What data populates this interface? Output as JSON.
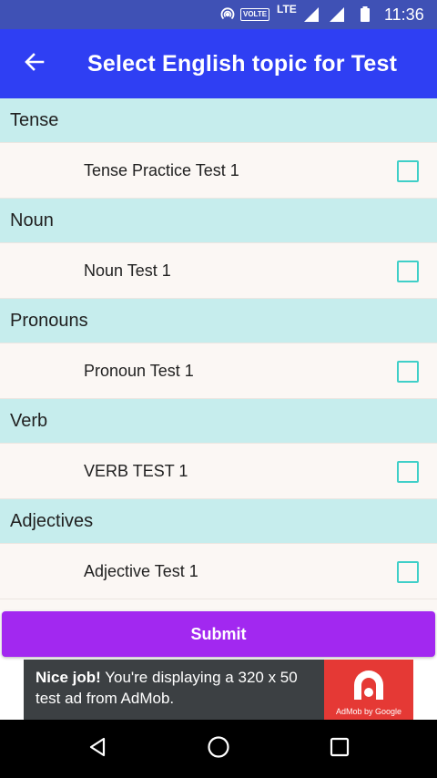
{
  "status_bar": {
    "network": "LTE",
    "volte": "VOLTE",
    "time": "11:36",
    "icons": [
      "hotspot-icon",
      "signal-icon",
      "signal-icon",
      "battery-icon"
    ]
  },
  "app_bar": {
    "title": "Select English topic for Test",
    "back_icon": "arrow-left-icon"
  },
  "sections": [
    {
      "header": "Tense",
      "tests": [
        {
          "label": "Tense Practice Test 1",
          "checked": false
        }
      ]
    },
    {
      "header": "Noun",
      "tests": [
        {
          "label": "Noun Test 1",
          "checked": false
        }
      ]
    },
    {
      "header": "Pronouns",
      "tests": [
        {
          "label": "Pronoun Test 1",
          "checked": false
        }
      ]
    },
    {
      "header": "Verb",
      "tests": [
        {
          "label": "VERB TEST 1",
          "checked": false
        }
      ]
    },
    {
      "header": "Adjectives",
      "tests": [
        {
          "label": "Adjective Test 1",
          "checked": false
        }
      ]
    }
  ],
  "submit": {
    "label": "Submit"
  },
  "ad": {
    "bold": "Nice job!",
    "text": " You're displaying a 320 x 50 test ad from AdMob.",
    "logo_caption": "AdMob by Google"
  },
  "nav_bar": {
    "icons": [
      "back-triangle-icon",
      "home-circle-icon",
      "recents-square-icon"
    ]
  },
  "colors": {
    "status_bar": "#3f51b5",
    "app_bar": "#2f3ff3",
    "section_header": "#c6eded",
    "row_bg": "#fbf7f4",
    "checkbox": "#3fcfc8",
    "submit": "#a228f0",
    "ad_bg": "#3c4043",
    "ad_logo": "#e53935"
  }
}
